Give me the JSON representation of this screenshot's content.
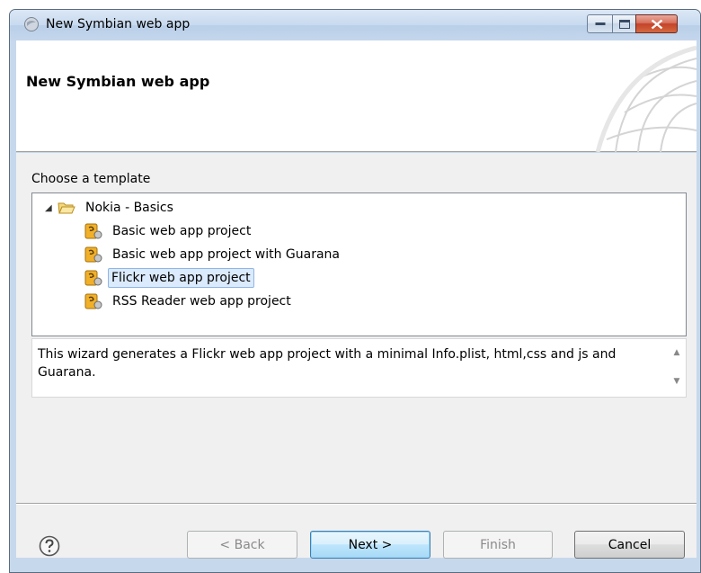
{
  "window": {
    "title": "New Symbian web app",
    "minimize_icon": "minimize-icon",
    "maximize_icon": "maximize-icon",
    "close_icon": "close-icon"
  },
  "banner": {
    "title": "New Symbian web app"
  },
  "template": {
    "section_label": "Choose a template",
    "tree": {
      "group_label": "Nokia - Basics",
      "group_icon": "folder-open-icon",
      "items": [
        {
          "label": "Basic web app project",
          "icon": "template-icon",
          "selected": false
        },
        {
          "label": "Basic web app project with Guarana",
          "icon": "template-icon",
          "selected": false
        },
        {
          "label": "Flickr web app project",
          "icon": "template-icon",
          "selected": true
        },
        {
          "label": "RSS Reader web app project",
          "icon": "template-icon",
          "selected": false
        }
      ]
    },
    "description": "This wizard generates a Flickr web app project with a minimal Info.plist, html,css and js and Guarana."
  },
  "footer": {
    "help_icon": "help-icon",
    "back_label": "< Back",
    "next_label": "Next >",
    "finish_label": "Finish",
    "cancel_label": "Cancel"
  }
}
